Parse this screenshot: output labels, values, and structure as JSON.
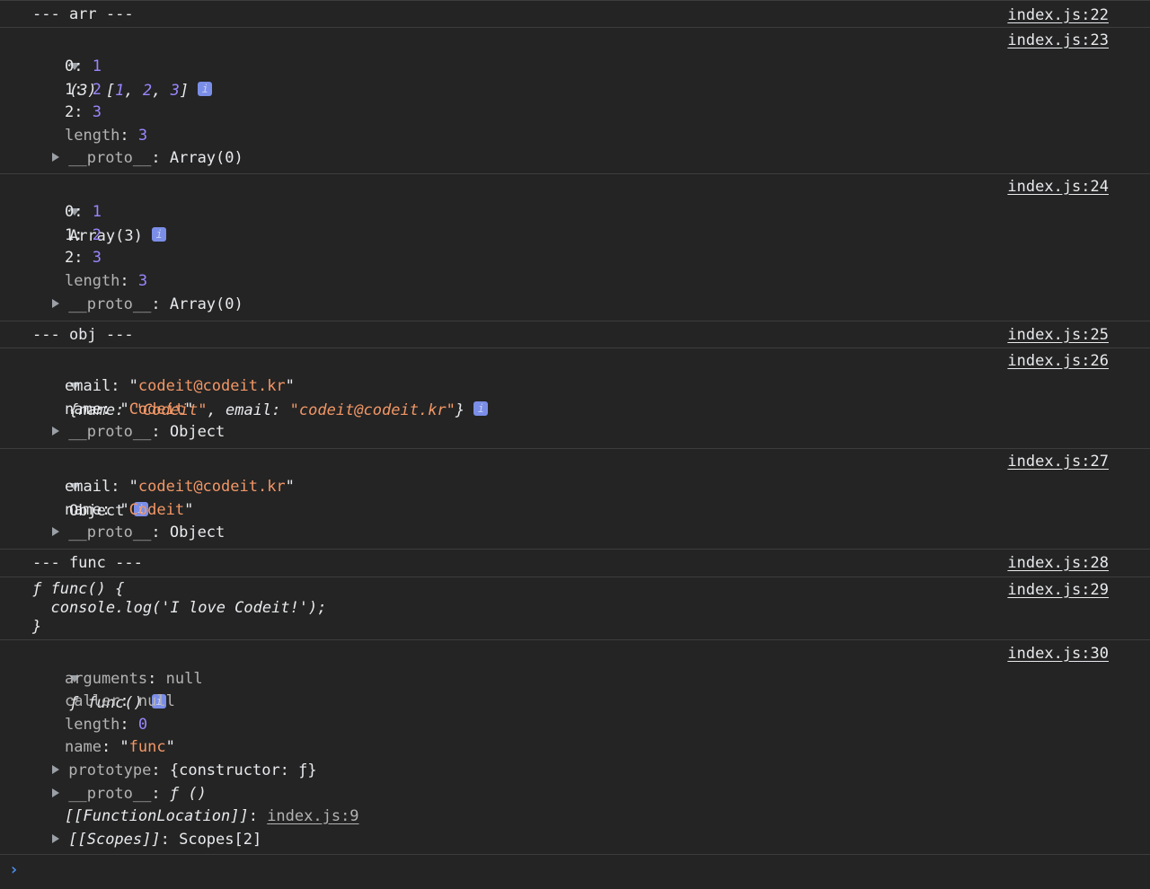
{
  "entries": {
    "arr_header": {
      "text": "--- arr ---",
      "src": "index.js:22"
    },
    "arr_literal": {
      "summary_count": "(3)",
      "summary_values": [
        "1",
        "2",
        "3"
      ],
      "src": "index.js:23",
      "items": [
        {
          "key": "0",
          "value": "1"
        },
        {
          "key": "1",
          "value": "2"
        },
        {
          "key": "2",
          "value": "3"
        }
      ],
      "length_key": "length",
      "length_value": "3",
      "proto_key": "__proto__",
      "proto_value": "Array(0)"
    },
    "arr_constructor": {
      "summary": "Array(3)",
      "src": "index.js:24",
      "items": [
        {
          "key": "0",
          "value": "1"
        },
        {
          "key": "1",
          "value": "2"
        },
        {
          "key": "2",
          "value": "3"
        }
      ],
      "length_key": "length",
      "length_value": "3",
      "proto_key": "__proto__",
      "proto_value": "Array(0)"
    },
    "obj_header": {
      "text": "--- obj ---",
      "src": "index.js:25"
    },
    "obj_literal": {
      "summary_name_key": "name",
      "summary_name_value": "\"Codeit\"",
      "summary_email_key": "email",
      "summary_email_value": "\"codeit@codeit.kr\"",
      "src": "index.js:26",
      "email_key": "email",
      "email_value": "codeit@codeit.kr",
      "name_key": "name",
      "name_value": "Codeit",
      "proto_key": "__proto__",
      "proto_value": "Object"
    },
    "obj_constructor": {
      "summary": "Object",
      "src": "index.js:27",
      "email_key": "email",
      "email_value": "codeit@codeit.kr",
      "name_key": "name",
      "name_value": "Codeit",
      "proto_key": "__proto__",
      "proto_value": "Object"
    },
    "func_header": {
      "text": "--- func ---",
      "src": "index.js:28"
    },
    "func_source": {
      "line1": "ƒ func() {",
      "line2": "  console.log('I love Codeit!');",
      "line3": "}",
      "src": "index.js:29"
    },
    "func_object": {
      "summary": "ƒ func()",
      "src": "index.js:30",
      "arguments_key": "arguments",
      "arguments_value": "null",
      "caller_key": "caller",
      "caller_value": "null",
      "length_key": "length",
      "length_value": "0",
      "name_key": "name",
      "name_value": "func",
      "prototype_key": "prototype",
      "prototype_value": "{constructor: ƒ}",
      "proto_key": "__proto__",
      "proto_value": "ƒ ()",
      "location_key": "[[FunctionLocation]]",
      "location_value": "index.js:9",
      "scopes_key": "[[Scopes]]",
      "scopes_value": "Scopes[2]"
    }
  },
  "info_badge": "i",
  "prompt_symbol": "›",
  "colors": {
    "background": "#242424",
    "number": "#9a86fd",
    "string": "#f29766",
    "info_badge": "#7b8ee7",
    "prompt": "#4a8ff0"
  }
}
